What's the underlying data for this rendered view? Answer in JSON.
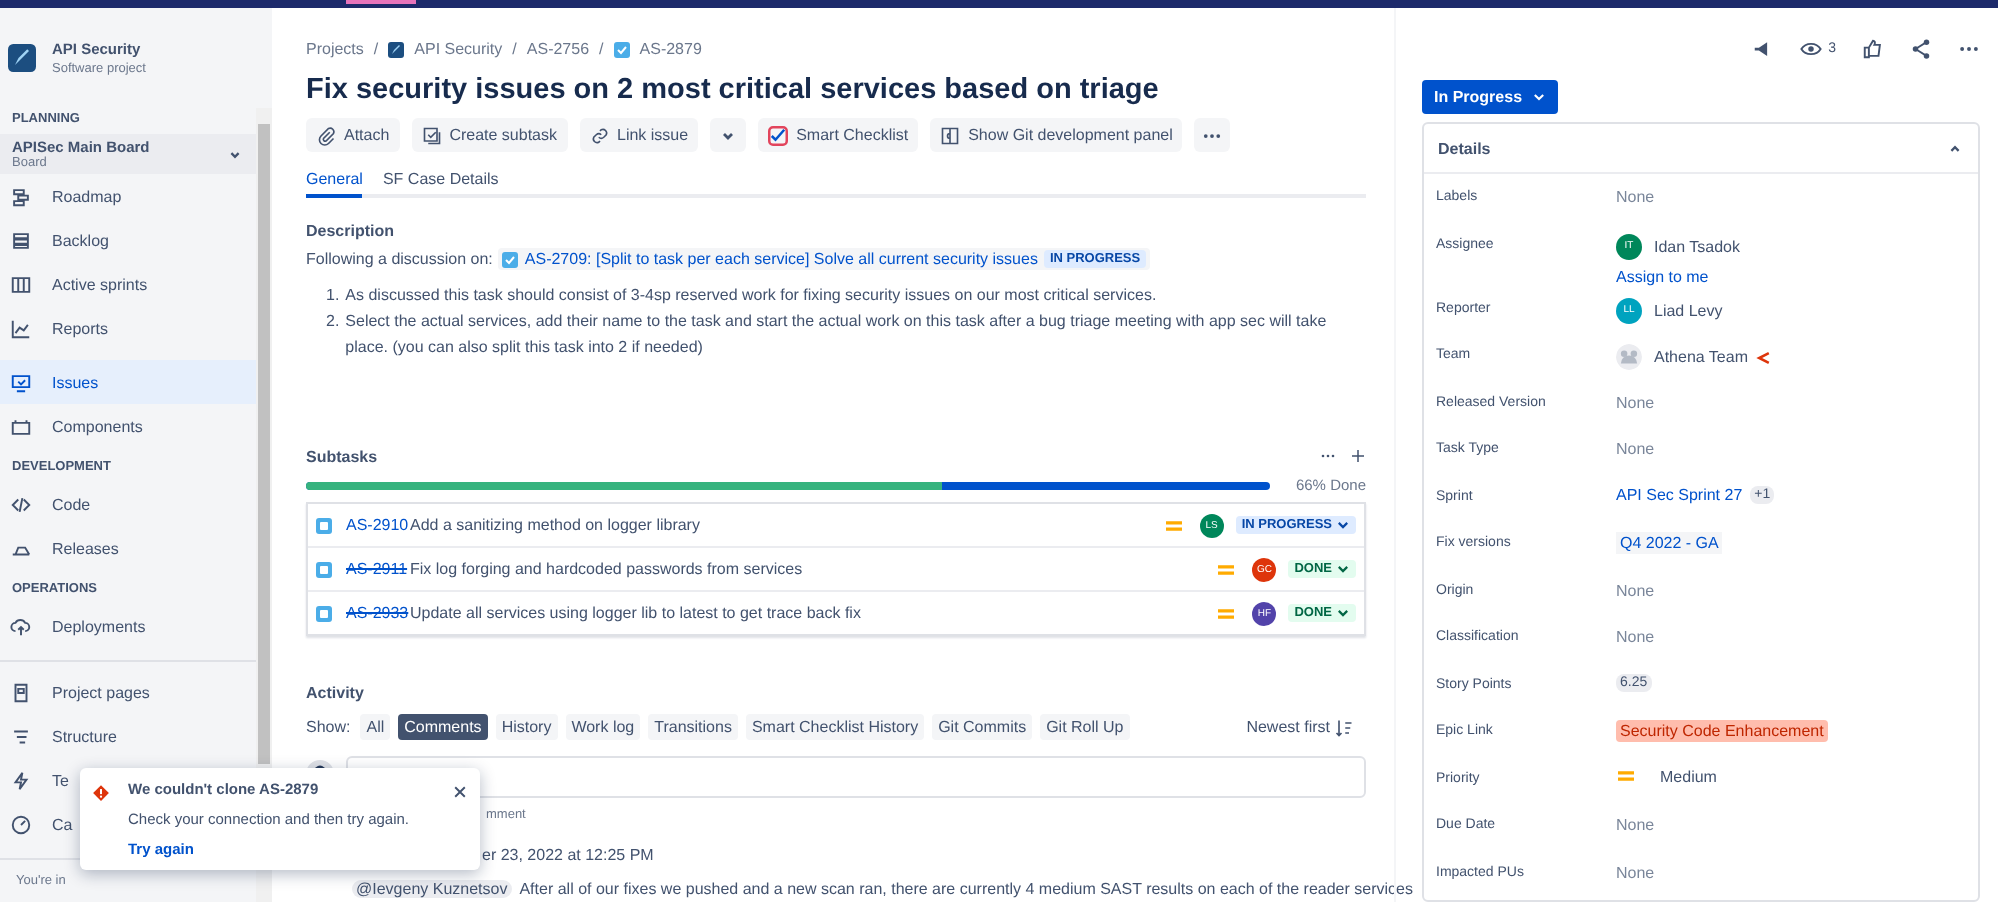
{
  "sidebar": {
    "project": {
      "name": "API Security",
      "type": "Software project"
    },
    "board": {
      "name": "APISec Main Board",
      "sub": "Board"
    },
    "groups": [
      {
        "heading": "PLANNING",
        "items": [
          {
            "label": "Roadmap",
            "selected": false
          },
          {
            "label": "Backlog",
            "selected": false
          },
          {
            "label": "Active sprints",
            "selected": false
          },
          {
            "label": "Reports",
            "selected": false
          }
        ]
      },
      {
        "items": [
          {
            "label": "Issues",
            "selected": true
          },
          {
            "label": "Components",
            "selected": false
          }
        ]
      },
      {
        "heading": "DEVELOPMENT",
        "items": [
          {
            "label": "Code",
            "selected": false
          },
          {
            "label": "Releases",
            "selected": false
          }
        ]
      },
      {
        "heading": "OPERATIONS",
        "items": [
          {
            "label": "Deployments",
            "selected": false
          }
        ]
      },
      {
        "divider": true,
        "items": [
          {
            "label": "Project pages",
            "selected": false
          },
          {
            "label": "Structure",
            "selected": false
          },
          {
            "label": "Te",
            "selected": false
          },
          {
            "label": "Ca",
            "selected": false
          }
        ]
      }
    ],
    "footer": "You're in"
  },
  "breadcrumbs": [
    {
      "kind": "text",
      "label": "Projects"
    },
    {
      "kind": "project",
      "sep": "/",
      "label": "API Security"
    },
    {
      "kind": "text",
      "sep": "/",
      "label": "AS-2756"
    },
    {
      "kind": "task",
      "sep": "/",
      "label": "AS-2879"
    }
  ],
  "title": "Fix security issues on 2 most critical services based on triage",
  "toolbar": [
    {
      "kind": "button",
      "label": "Attach"
    },
    {
      "kind": "button",
      "label": "Create subtask"
    },
    {
      "kind": "button",
      "label": "Link issue"
    },
    {
      "kind": "dropdown"
    },
    {
      "kind": "button",
      "label": "Smart Checklist"
    },
    {
      "kind": "button",
      "label": "Show Git development panel"
    },
    {
      "kind": "more"
    }
  ],
  "tabs": [
    {
      "label": "General",
      "selected": true
    },
    {
      "label": "SF Case Details",
      "selected": false
    }
  ],
  "description": {
    "heading": "Description",
    "lead": "Following a discussion on:",
    "link": "AS-2709: [Split to task per each service] Solve all current security issues",
    "link_status": "IN PROGRESS",
    "points": [
      {
        "marker": "1.",
        "text": "As discussed this task should consist of 3-4sp reserved work for fixing security issues on our most critical services."
      },
      {
        "marker": "2.",
        "text": "Select the actual services, add their name to the task and start the actual work on this task after a bug triage meeting with app sec will take place. (you can also split this task into 2 if needed)"
      }
    ]
  },
  "subtasks": {
    "heading": "Subtasks",
    "level": 0.66,
    "progress_label": "66% Done",
    "rows": [
      {
        "key": "AS-2910",
        "summary": "Add a sanitizing method on logger library",
        "initials": "LS",
        "color": "#00875a",
        "status": "IN PROGRESS",
        "done": false
      },
      {
        "key": "AS-2911",
        "summary": "Fix log forging and hardcoded passwords from services",
        "initials": "GC",
        "color": "#de350b",
        "status": "DONE",
        "done": true
      },
      {
        "key": "AS-2933",
        "summary": "Update all services using logger lib to latest to get trace back fix",
        "initials": "HF",
        "color": "#5243aa",
        "status": "DONE",
        "done": true
      }
    ]
  },
  "activity": {
    "heading": "Activity",
    "show_label": "Show:",
    "filters": [
      {
        "label": "All",
        "selected": false
      },
      {
        "label": "Comments",
        "selected": true
      },
      {
        "label": "History",
        "selected": false
      },
      {
        "label": "Work log",
        "selected": false
      },
      {
        "label": "Transitions",
        "selected": false
      },
      {
        "label": "Smart Checklist History",
        "selected": false
      },
      {
        "label": "Git Commits",
        "selected": false
      },
      {
        "label": "Git Roll Up",
        "selected": false
      }
    ],
    "sort": "Newest first",
    "hint": "mment",
    "comment_date": "er 23, 2022 at 12:25 PM",
    "mention": "@Ievgeny Kuznetsov",
    "comment_text": "After all of our fixes we pushed and a new scan ran, there are currently 4 medium SAST results on each of the reader services"
  },
  "toast": {
    "title": "We couldn't clone AS-2879",
    "message": "Check your connection and then try again.",
    "action": "Try again"
  },
  "header_actions": {
    "watchers": "3"
  },
  "status_button": "In Progress",
  "details": {
    "heading": "Details",
    "fields": [
      {
        "label": "Labels",
        "kind": "none",
        "value": "None"
      },
      {
        "label": "Assignee",
        "kind": "user",
        "value": "Idan Tsadok",
        "initials": "IT",
        "color": "#00875a",
        "action": "Assign to me"
      },
      {
        "label": "Reporter",
        "kind": "user",
        "value": "Liad Levy",
        "initials": "LL",
        "color": "#00a3bf"
      },
      {
        "label": "Team",
        "kind": "team",
        "value": "Athena Team"
      },
      {
        "label": "Released Version",
        "kind": "none",
        "value": "None"
      },
      {
        "label": "Task Type",
        "kind": "none",
        "value": "None"
      },
      {
        "label": "Sprint",
        "kind": "sprint",
        "value": "API Sec Sprint 27",
        "extra": "+1"
      },
      {
        "label": "Fix versions",
        "kind": "version",
        "value": "Q4 2022 - GA"
      },
      {
        "label": "Origin",
        "kind": "none",
        "value": "None"
      },
      {
        "label": "Classification",
        "kind": "none",
        "value": "None"
      },
      {
        "label": "Story Points",
        "kind": "points",
        "value": "6.25"
      },
      {
        "label": "Epic Link",
        "kind": "epic",
        "value": "Security Code Enhancement"
      },
      {
        "label": "Priority",
        "kind": "priority",
        "value": "Medium"
      },
      {
        "label": "Due Date",
        "kind": "none",
        "value": "None"
      },
      {
        "label": "Impacted PUs",
        "kind": "none",
        "value": "None"
      }
    ]
  }
}
